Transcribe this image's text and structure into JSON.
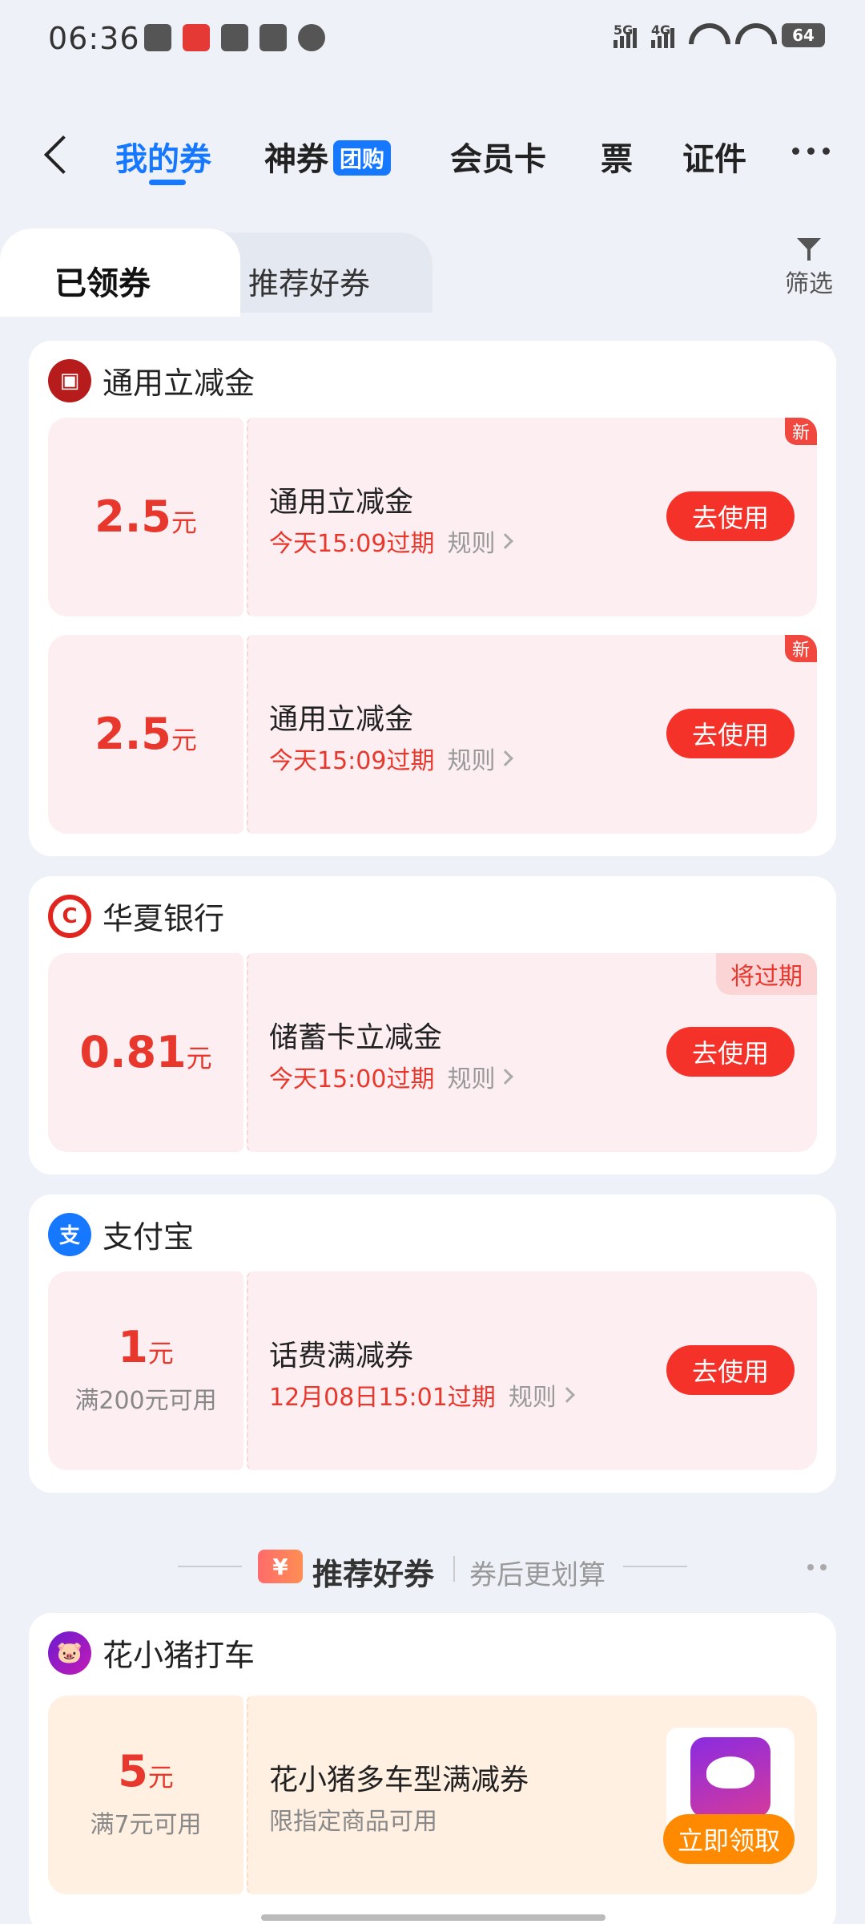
{
  "status_bar": {
    "time": "06:36",
    "battery": "64",
    "sig1": "5G",
    "sig2": "4G"
  },
  "nav": {
    "tabs": [
      {
        "label": "我的券"
      },
      {
        "label": "神券",
        "badge": "团购"
      },
      {
        "label": "会员卡"
      },
      {
        "label": "票"
      },
      {
        "label": "证件"
      }
    ]
  },
  "subtabs": {
    "active": "已领券",
    "inactive": "推荐好券",
    "filter": "筛选"
  },
  "groups": [
    {
      "brand": "通用立减金",
      "coupons": [
        {
          "amount": "2.5",
          "unit": "元",
          "title": "通用立减金",
          "expire": "今天15:09过期",
          "rules": "规则",
          "action": "去使用",
          "tag": "新"
        },
        {
          "amount": "2.5",
          "unit": "元",
          "title": "通用立减金",
          "expire": "今天15:09过期",
          "rules": "规则",
          "action": "去使用",
          "tag": "新"
        }
      ]
    },
    {
      "brand": "华夏银行",
      "coupons": [
        {
          "amount": "0.81",
          "unit": "元",
          "title": "储蓄卡立减金",
          "expire": "今天15:00过期",
          "rules": "规则",
          "action": "去使用",
          "tag": "将过期"
        }
      ]
    },
    {
      "brand": "支付宝",
      "logo_text": "支",
      "coupons": [
        {
          "amount": "1",
          "unit": "元",
          "condition": "满200元可用",
          "title": "话费满减券",
          "expire": "12月08日15:01过期",
          "rules": "规则",
          "action": "去使用"
        }
      ]
    }
  ],
  "recommend": {
    "icon": "¥",
    "title": "推荐好券",
    "subtitle": "券后更划算",
    "brand": "花小猪打车",
    "coupon": {
      "amount": "5",
      "unit": "元",
      "condition": "满7元可用",
      "title": "花小猪多车型满减券",
      "desc": "限指定商品可用",
      "action": "立即领取"
    }
  },
  "colors": {
    "accent": "#1677ff",
    "coupon_red": "#e8372c",
    "button_red": "#f5322a",
    "button_orange": "#ff8a00"
  }
}
